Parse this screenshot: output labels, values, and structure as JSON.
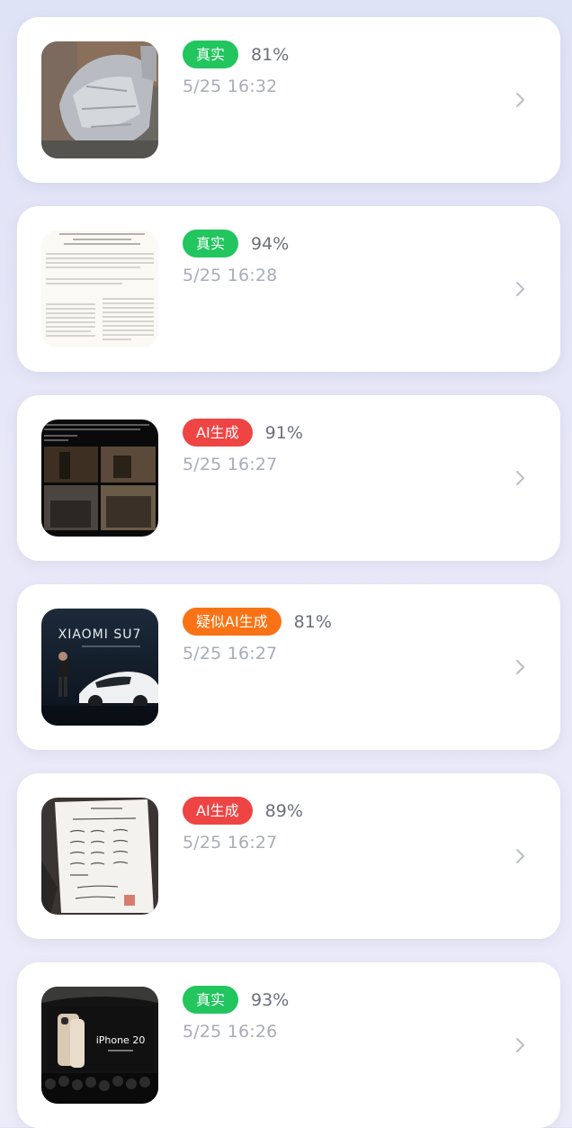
{
  "history": {
    "items": [
      {
        "label": "真实",
        "label_color": "#22c55e",
        "score": "81%",
        "time": "5/25 16:32",
        "thumb": "motorcycle-cover-photo"
      },
      {
        "label": "真实",
        "label_color": "#22c55e",
        "score": "94%",
        "time": "5/25 16:28",
        "thumb": "document-scan"
      },
      {
        "label": "AI生成",
        "label_color": "#ef4444",
        "score": "91%",
        "time": "5/25 16:27",
        "thumb": "news-collage"
      },
      {
        "label": "疑似AI生成",
        "label_color": "#f97316",
        "score": "81%",
        "time": "5/25 16:27",
        "thumb": "xiaomi-su7-launch",
        "thumb_text": "XIAOMI SU7"
      },
      {
        "label": "AI生成",
        "label_color": "#ef4444",
        "score": "89%",
        "time": "5/25 16:27",
        "thumb": "handwritten-note"
      },
      {
        "label": "真实",
        "label_color": "#22c55e",
        "score": "93%",
        "time": "5/25 16:26",
        "thumb": "iphone-launch-event",
        "thumb_text": "iPhone 20"
      }
    ]
  },
  "icons": {
    "chevron": "chevron-right-icon"
  }
}
